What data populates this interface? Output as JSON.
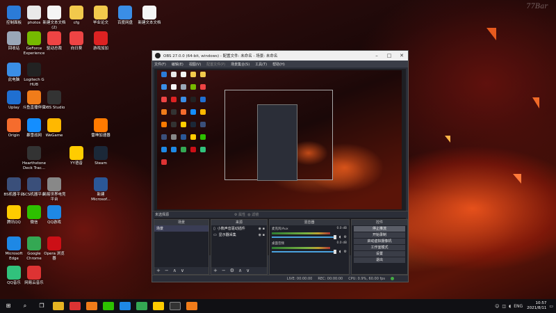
{
  "watermark": "77Bar",
  "desktop": {
    "icons": [
      {
        "label": "控制面板",
        "color": "#2b7bd8",
        "icon": "control-panel-icon"
      },
      {
        "label": "photos",
        "color": "#e9e9e9",
        "icon": "folder-icon"
      },
      {
        "label": "新建文本文档\n(2)",
        "color": "#f5f5f5",
        "icon": "text-file-icon"
      },
      {
        "label": "cfg",
        "color": "#f2c94c",
        "icon": "folder-icon"
      },
      {
        "label": "毕业论文",
        "color": "#f2c94c",
        "icon": "folder-icon"
      },
      {
        "label": "百度网盘",
        "color": "#3a8ee6",
        "icon": "cloud-icon"
      },
      {
        "label": "新建文本文档",
        "color": "#f5f5f5",
        "icon": "text-file-icon"
      },
      {
        "label": "回收站",
        "color": "#9aa7b8",
        "icon": "recycle-bin-icon"
      },
      {
        "label": "GeForce\nExperience",
        "color": "#76b900",
        "icon": "geforce-icon"
      },
      {
        "label": "驱动总裁",
        "color": "#e44",
        "icon": "driver-icon"
      },
      {
        "label": "向日葵",
        "color": "#e44",
        "icon": "sunflower-icon"
      },
      {
        "label": "游戏加加",
        "color": "#d22",
        "icon": "game-icon"
      },
      {
        "label": "此电脑",
        "color": "#3a8ee6",
        "icon": "computer-icon"
      },
      {
        "label": "Logitech G\nHUB",
        "color": "#222",
        "icon": "logitech-icon"
      },
      {
        "label": "Uplay",
        "color": "#1f6fd1",
        "icon": "uplay-icon"
      },
      {
        "label": "斗鱼直播伴侣",
        "color": "#f07c1a",
        "icon": "douyu-icon"
      },
      {
        "label": "OBS Studio",
        "color": "#333",
        "icon": "obs-icon"
      },
      {
        "label": "Origin",
        "color": "#f56c2d",
        "icon": "origin-icon"
      },
      {
        "label": "暴雪战网",
        "color": "#148eff",
        "icon": "battlenet-icon"
      },
      {
        "label": "WeGame",
        "color": "#ffb800",
        "icon": "wegame-icon"
      },
      {
        "label": "雷神加速器",
        "color": "#ff7a00",
        "icon": "thunder-icon"
      },
      {
        "label": "Hearthstone\nDeck Trac...",
        "color": "#333",
        "icon": "hearthstone-icon"
      },
      {
        "label": "YY语音",
        "color": "#ffcc00",
        "icon": "yy-icon"
      },
      {
        "label": "Steam",
        "color": "#1b2838",
        "icon": "steam-icon"
      },
      {
        "label": "BS机器平台",
        "color": "#3a4f7a",
        "icon": "app-icon"
      },
      {
        "label": "SCS机器平台",
        "color": "#3a4f7a",
        "icon": "app-icon"
      },
      {
        "label": "网易世界电竞\n平台",
        "color": "#888",
        "icon": "app-icon"
      },
      {
        "label": "新建\nMicrosof...",
        "color": "#2b5797",
        "icon": "word-icon"
      },
      {
        "label": "腾讯QQ",
        "color": "#ffcc00",
        "icon": "qq-icon"
      },
      {
        "label": "微信",
        "color": "#2dc100",
        "icon": "wechat-icon"
      },
      {
        "label": "QQ游戏",
        "color": "#1e88e5",
        "icon": "qqgame-icon"
      },
      {
        "label": "Microsoft\nEdge",
        "color": "#1e88e5",
        "icon": "edge-icon"
      },
      {
        "label": "Google\nChrome",
        "color": "#34a853",
        "icon": "chrome-icon"
      },
      {
        "label": "Opera 浏览\n器",
        "color": "#cc0f16",
        "icon": "opera-icon"
      },
      {
        "label": "QQ音乐",
        "color": "#31c27c",
        "icon": "qqmusic-icon"
      },
      {
        "label": "网易云音乐",
        "color": "#d33",
        "icon": "netease-icon"
      }
    ]
  },
  "obs": {
    "title": "OBS 27.0.0 (64-bit, windows) - 配置文件: 未命名 - 场景: 未命名",
    "menu": [
      "文件(F)",
      "编辑(E)",
      "视图(V)",
      "配置文件(P)",
      "场景集合(S)",
      "工具(T)",
      "帮助(H)"
    ],
    "scene_bar_label": "未选择源",
    "filters_labels": [
      "属性",
      "滤镜"
    ],
    "docks": {
      "scenes": {
        "title": "场景",
        "items": [
          "场景"
        ]
      },
      "sources": {
        "title": "来源",
        "items": [
          {
            "label": "小熊声音驱动插件",
            "icon": "mic-icon"
          },
          {
            "label": "显示器采集",
            "icon": "monitor-icon"
          }
        ]
      },
      "mixer": {
        "title": "混音器",
        "channels": [
          {
            "name": "麦克风/Aux",
            "db": "0.0 dB",
            "level": 0.78
          },
          {
            "name": "桌面音频",
            "db": "0.0 dB",
            "level": 0.78
          }
        ]
      },
      "controls": {
        "title": "控件",
        "buttons": [
          "停止推流",
          "开始录制",
          "启动虚拟摄像机",
          "工作室模式",
          "设置",
          "退出"
        ]
      }
    },
    "status": {
      "live": "LIVE: 00:00:00",
      "rec": "REC: 00:00:00",
      "cpu": "CPU: 0.9%, 60.00 fps"
    }
  },
  "taskbar": {
    "time": "10:57",
    "date": "2021/8/11",
    "lang": "ENG"
  }
}
